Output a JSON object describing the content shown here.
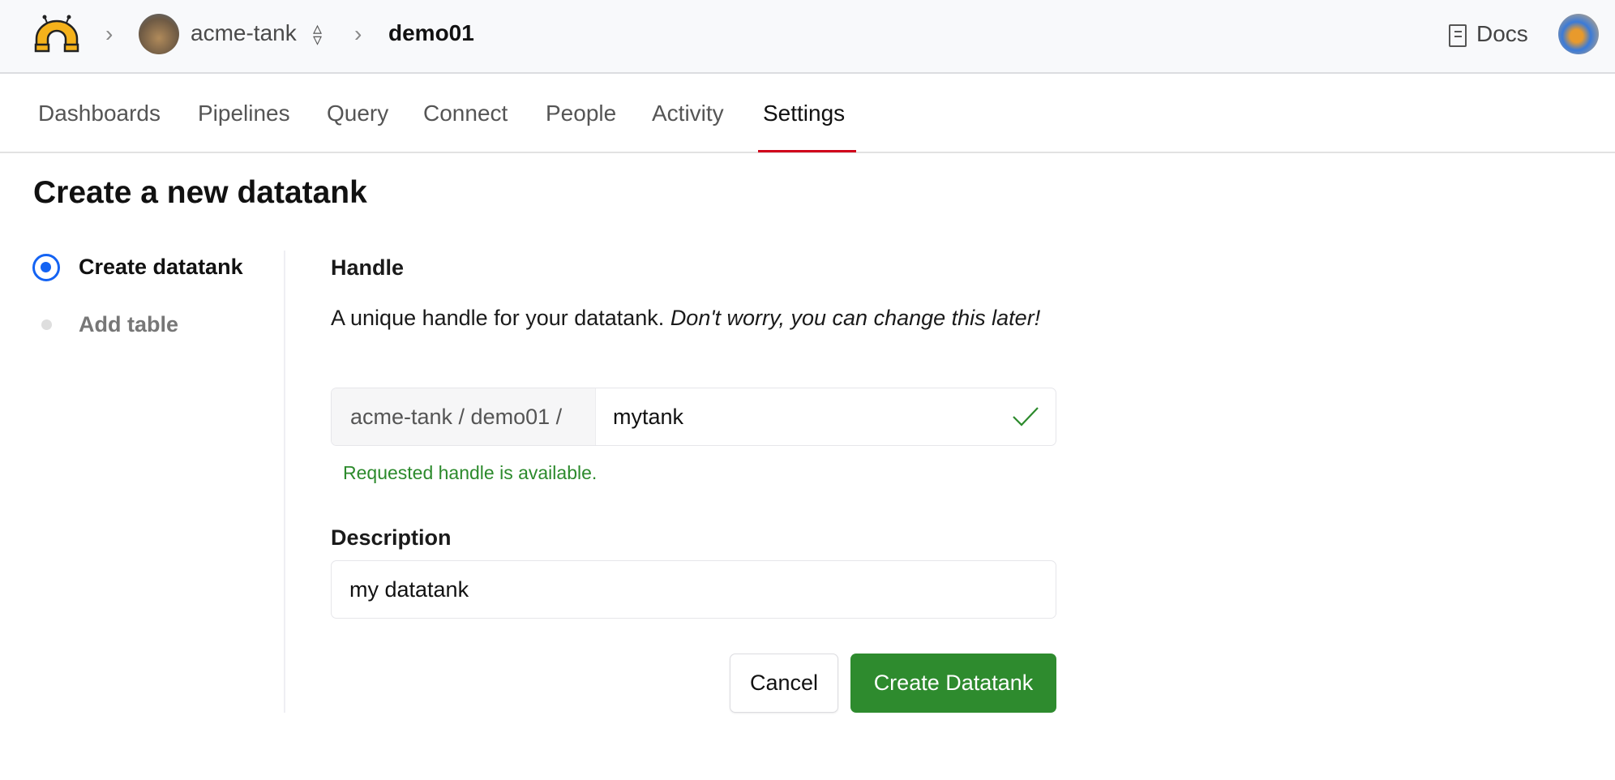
{
  "header": {
    "logo_icon": "magnet-logo-icon",
    "org": {
      "name": "acme-tank",
      "avatar": "tank-avatar",
      "switch_icon": "up-down-icon"
    },
    "project": "demo01",
    "docs_label": "Docs",
    "docs_icon": "book-icon",
    "user_avatar": "user-avatar"
  },
  "tabs": [
    {
      "label": "Dashboards",
      "active": false
    },
    {
      "label": "Pipelines",
      "active": false
    },
    {
      "label": "Query",
      "active": false
    },
    {
      "label": "Connect",
      "active": false
    },
    {
      "label": "People",
      "active": false
    },
    {
      "label": "Activity",
      "active": false
    },
    {
      "label": "Settings",
      "active": true
    }
  ],
  "page": {
    "title": "Create a new datatank",
    "steps": [
      {
        "label": "Create datatank",
        "state": "current"
      },
      {
        "label": "Add table",
        "state": "pending"
      }
    ]
  },
  "form": {
    "handle_label": "Handle",
    "handle_help": "A unique handle for your datatank. ",
    "handle_help_italic": "Don't worry, you can change this later!",
    "handle_prefix": "acme-tank / demo01 /",
    "handle_value": "mytank",
    "handle_status": "Requested handle is available.",
    "description_label": "Description",
    "description_value": "my datatank",
    "cancel_label": "Cancel",
    "submit_label": "Create Datatank"
  },
  "colors": {
    "accent_tab": "#d0021b",
    "primary_button": "#2e8b2e",
    "success": "#2c8a2c",
    "step_active": "#1463f3"
  }
}
